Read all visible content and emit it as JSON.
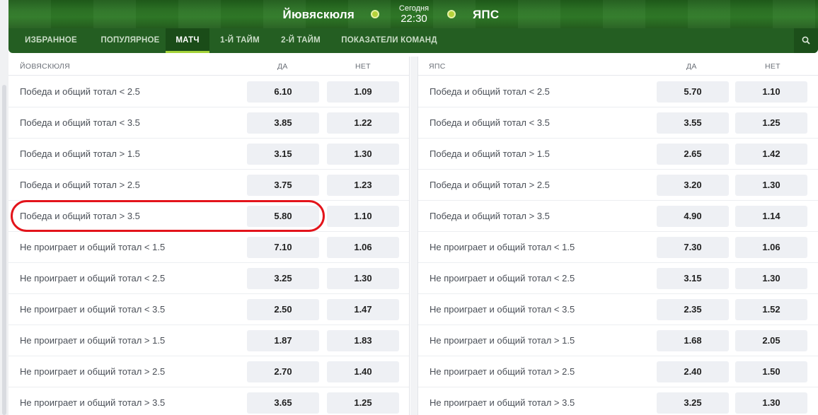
{
  "match": {
    "home_team": "Йювяскюля",
    "away_team": "ЯПС",
    "day": "Сегодня",
    "time": "22:30"
  },
  "tabs": [
    {
      "label": "ИЗБРАННОЕ",
      "active": false
    },
    {
      "label": "ПОПУЛЯРНОЕ",
      "active": false
    },
    {
      "label": "МАТЧ",
      "active": true
    },
    {
      "label": "1-Й ТАЙМ",
      "active": false
    },
    {
      "label": "2-Й ТАЙМ",
      "active": false
    },
    {
      "label": "ПОКАЗАТЕЛИ КОМАНД",
      "active": false
    }
  ],
  "columns": {
    "yes": "ДА",
    "no": "НЕТ"
  },
  "left": {
    "title": "ЙОВЯСКЮЛЯ",
    "rows": [
      {
        "label": "Победа и общий тотал < 2.5",
        "yes": "6.10",
        "no": "1.09"
      },
      {
        "label": "Победа и общий тотал < 3.5",
        "yes": "3.85",
        "no": "1.22"
      },
      {
        "label": "Победа и общий тотал > 1.5",
        "yes": "3.15",
        "no": "1.30"
      },
      {
        "label": "Победа и общий тотал > 2.5",
        "yes": "3.75",
        "no": "1.23"
      },
      {
        "label": "Победа и общий тотал > 3.5",
        "yes": "5.80",
        "no": "1.10"
      },
      {
        "label": "Не проиграет и общий тотал < 1.5",
        "yes": "7.10",
        "no": "1.06"
      },
      {
        "label": "Не проиграет и общий тотал < 2.5",
        "yes": "3.25",
        "no": "1.30"
      },
      {
        "label": "Не проиграет и общий тотал < 3.5",
        "yes": "2.50",
        "no": "1.47"
      },
      {
        "label": "Не проиграет и общий тотал > 1.5",
        "yes": "1.87",
        "no": "1.83"
      },
      {
        "label": "Не проиграет и общий тотал > 2.5",
        "yes": "2.70",
        "no": "1.40"
      },
      {
        "label": "Не проиграет и общий тотал > 3.5",
        "yes": "3.65",
        "no": "1.25"
      }
    ]
  },
  "right": {
    "title": "ЯПС",
    "rows": [
      {
        "label": "Победа и общий тотал < 2.5",
        "yes": "5.70",
        "no": "1.10"
      },
      {
        "label": "Победа и общий тотал < 3.5",
        "yes": "3.55",
        "no": "1.25"
      },
      {
        "label": "Победа и общий тотал > 1.5",
        "yes": "2.65",
        "no": "1.42"
      },
      {
        "label": "Победа и общий тотал > 2.5",
        "yes": "3.20",
        "no": "1.30"
      },
      {
        "label": "Победа и общий тотал > 3.5",
        "yes": "4.90",
        "no": "1.14"
      },
      {
        "label": "Не проиграет и общий тотал < 1.5",
        "yes": "7.30",
        "no": "1.06"
      },
      {
        "label": "Не проиграет и общий тотал < 2.5",
        "yes": "3.15",
        "no": "1.30"
      },
      {
        "label": "Не проиграет и общий тотал < 3.5",
        "yes": "2.35",
        "no": "1.52"
      },
      {
        "label": "Не проиграет и общий тотал > 1.5",
        "yes": "1.68",
        "no": "2.05"
      },
      {
        "label": "Не проиграет и общий тотал > 2.5",
        "yes": "2.40",
        "no": "1.50"
      },
      {
        "label": "Не проиграет и общий тотал > 3.5",
        "yes": "3.25",
        "no": "1.30"
      }
    ]
  },
  "icons": {
    "search": "search-icon"
  },
  "colors": {
    "header_green": "#2f7a27",
    "nav_green": "#245e22",
    "accent": "#a5d33a",
    "highlight": "#e3141b"
  }
}
